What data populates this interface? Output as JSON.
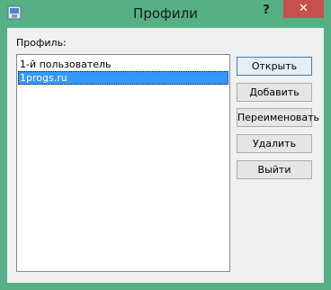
{
  "window": {
    "title": "Профили",
    "help_label": "?",
    "close_label": "✕"
  },
  "profile_label": "Профиль:",
  "profiles": [
    "1-й пользователь",
    "1progs.ru"
  ],
  "selected_profile": "1progs.ru",
  "buttons": {
    "open": "Открыть",
    "add": "Добавить",
    "rename": "Переименовать",
    "delete": "Удалить",
    "exit": "Выйти"
  },
  "colors": {
    "frame": "#55b086",
    "close": "#c7504f",
    "selection": "#3399ff"
  }
}
